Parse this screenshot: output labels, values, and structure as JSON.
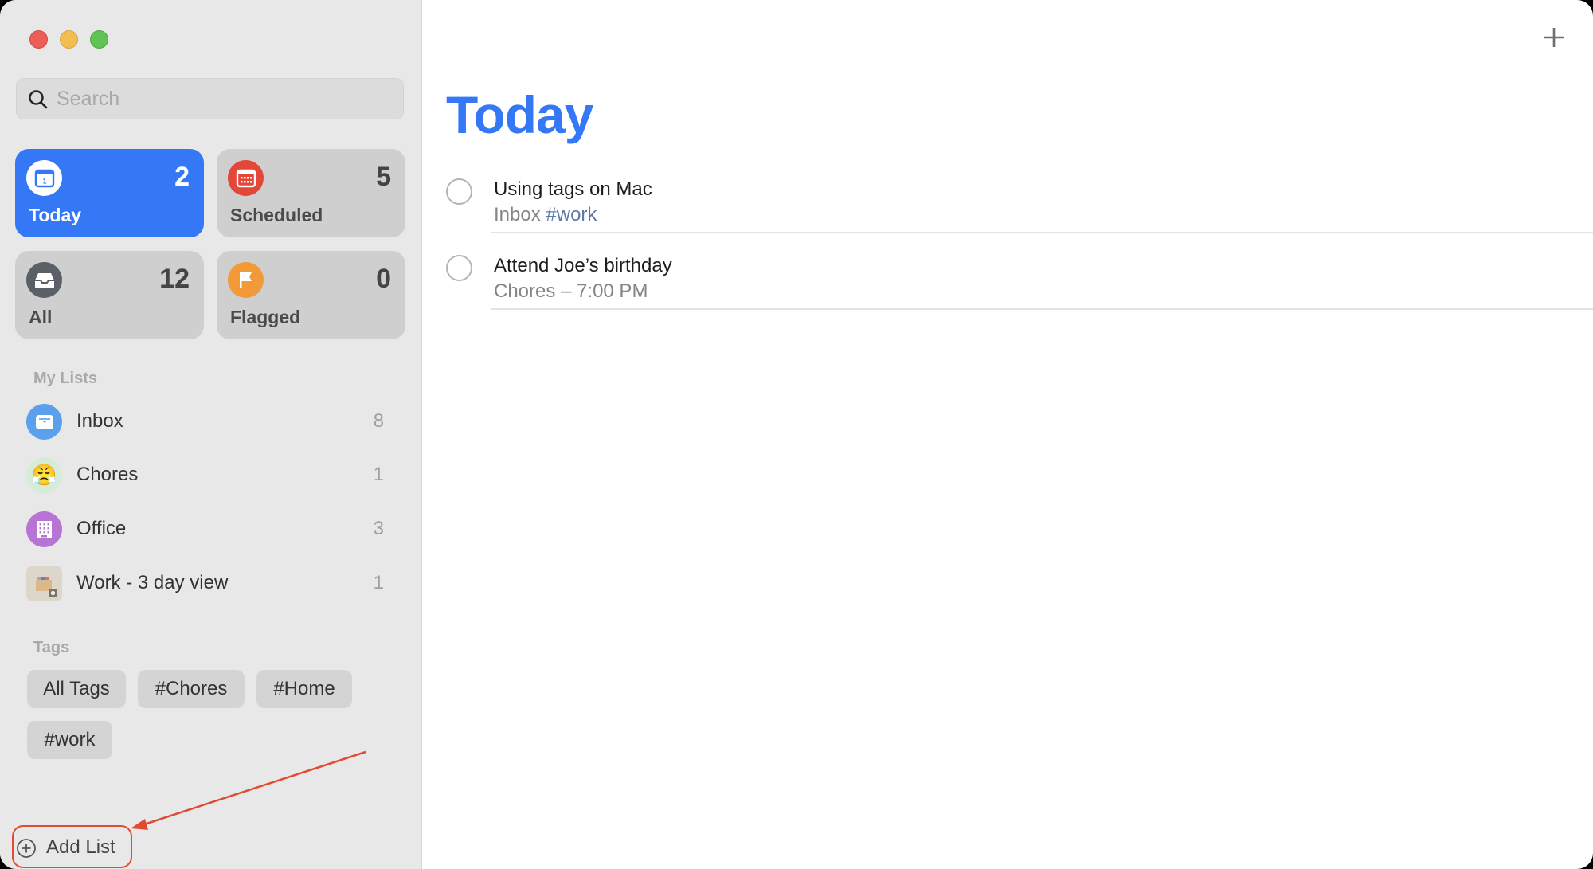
{
  "window": {
    "controls": [
      "close",
      "minimize",
      "zoom"
    ]
  },
  "sidebar": {
    "search": {
      "placeholder": "Search",
      "value": ""
    },
    "smart_lists": [
      {
        "label": "Today",
        "count": "2",
        "icon": "calendar-today-icon",
        "color": "#3478f6",
        "selected": true
      },
      {
        "label": "Scheduled",
        "count": "5",
        "icon": "calendar-icon",
        "color": "#e5463a"
      },
      {
        "label": "All",
        "count": "12",
        "icon": "tray-icon",
        "color": "#5b5f66"
      },
      {
        "label": "Flagged",
        "count": "0",
        "icon": "flag-icon",
        "color": "#f19a37"
      }
    ],
    "my_lists_label": "My Lists",
    "lists": [
      {
        "name": "Inbox",
        "count": "8",
        "icon": "inbox-icon",
        "color": "#5aa0ec"
      },
      {
        "name": "Chores",
        "count": "1",
        "icon": "emoji-steam-face-icon",
        "emoji": "😤",
        "color": "#d5ecd6"
      },
      {
        "name": "Office",
        "count": "3",
        "icon": "building-icon",
        "color": "#b774d4"
      },
      {
        "name": "Work - 3 day view",
        "count": "1",
        "icon": "box-smart-list-icon",
        "color": "#ddd6cb"
      }
    ],
    "tags_label": "Tags",
    "tags": [
      "All Tags",
      "#Chores",
      "#Home",
      "#work"
    ],
    "add_list_label": "Add List"
  },
  "main": {
    "title": "Today",
    "add_button": "plus-icon",
    "tasks": [
      {
        "title": "Using tags on Mac",
        "list": "Inbox",
        "tag": "#work",
        "detail": ""
      },
      {
        "title": "Attend Joe’s birthday",
        "list": "Chores",
        "tag": "",
        "detail": "Chores – 7:00 PM"
      }
    ]
  },
  "colors": {
    "accent": "#3478f6",
    "annotation": "#e14b32"
  }
}
